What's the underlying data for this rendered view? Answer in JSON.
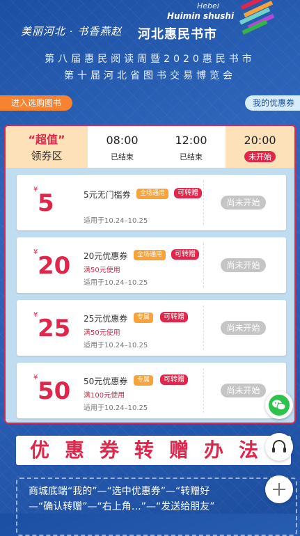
{
  "header": {
    "calligraphy": "美丽河北 · 书香燕赵",
    "brand_cn": "河北惠民书市",
    "brand_en_1": "Hebei",
    "brand_en_2": "Huimin shushi",
    "subtitle_1": "第八届惠民阅读周暨2020惠民书市",
    "subtitle_2": "第十届河北省图书交易博览会"
  },
  "actions": {
    "enter_label": "进入选购图书",
    "mine_label": "我的优惠券"
  },
  "tabs": {
    "zone_title": "“超值”",
    "zone_sub": "领券区",
    "slots": [
      {
        "time": "08:00",
        "status": "已结束"
      },
      {
        "time": "12:00",
        "status": "已结束"
      },
      {
        "time": "20:00",
        "status": "未开始"
      }
    ]
  },
  "coupons": [
    {
      "yen": "¥",
      "amount": "5",
      "name": "5元无门槛券",
      "scope": "全场通用",
      "give": "可转赠",
      "cond": "",
      "date": "适用于10.24–10.25",
      "status": "尚未开始"
    },
    {
      "yen": "¥",
      "amount": "20",
      "name": "20元优惠券",
      "scope": "全场通用",
      "give": "可转赠",
      "cond": "满50元使用",
      "date": "适用于10.24–10.25",
      "status": "尚未开始"
    },
    {
      "yen": "¥",
      "amount": "25",
      "name": "25元优惠券",
      "scope": "专属",
      "give": "可转赠",
      "cond": "满50元使用",
      "date": "适用于10.24–10.25",
      "status": "尚未开始"
    },
    {
      "yen": "¥",
      "amount": "50",
      "name": "50元优惠券",
      "scope": "专属",
      "give": "可转赠",
      "cond": "满100元使用",
      "date": "适用于10.24–10.25",
      "status": "尚未开始"
    }
  ],
  "banner": {
    "title": "优惠券转赠办法"
  },
  "instructions": {
    "line_1": "商城底端“我的”—“选中优惠券”—“转赠好",
    "line_2": "—“确认转赠”—“右上角…”—“发送给朋友”"
  },
  "icons": [
    "logo-icon",
    "wechat-icon",
    "headset-icon",
    "plus-icon"
  ],
  "colors": {
    "accent_red": "#e0264b",
    "accent_orange": "#f7822f",
    "bg_blue": "#2a5fb6"
  }
}
